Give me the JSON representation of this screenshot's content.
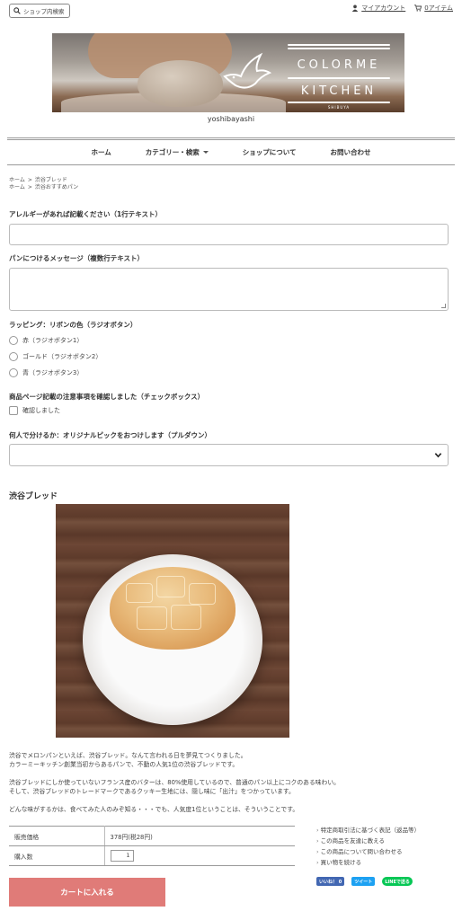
{
  "header": {
    "search_label": "ショップ内検索",
    "account_label": "マイアカウント",
    "cart_label": "0アイテム"
  },
  "banner": {
    "title_line1": "COLORME",
    "title_line2": "KITCHEN",
    "subtitle": "SHIBUYA"
  },
  "shop_name": "yoshibayashi",
  "nav": {
    "items": [
      "ホーム",
      "カテゴリー・検索",
      "ショップについて",
      "お問い合わせ"
    ]
  },
  "breadcrumb": {
    "row1": [
      "ホーム",
      "渋谷ブレッド"
    ],
    "row2": [
      "ホーム",
      "渋谷おすすめパン"
    ]
  },
  "form": {
    "allergy_label": "アレルギーがあれば記載ください（1行テキスト）",
    "message_label": "パンにつけるメッセージ（複数行テキスト）",
    "wrapping_label": "ラッピング：リボンの色（ラジオボタン）",
    "radio_options": [
      "赤（ラジオボタン1）",
      "ゴールド（ラジオボタン2）",
      "青（ラジオボタン3）"
    ],
    "notice_label": "商品ページ記載の注意事項を確認しました（チェックボックス）",
    "notice_checkbox": "確認しました",
    "share_label": "何人で分けるか：オリジナルピックをおつけします（プルダウン）"
  },
  "product": {
    "title": "渋谷ブレッド",
    "desc": [
      "渋谷でメロンパンといえば、渋谷ブレッド。なんて言われる日を夢見てつくりました。",
      "カラーミーキッチン創業当初からあるパンで、不動の人気1位の渋谷ブレッドです。",
      "",
      "渋谷ブレッドにしか使っていないフランス産のバターは、80%使用しているので、普通のパン以上にコクのある味わい。",
      "そして、渋谷ブレッドのトレードマークであるクッキー生地には、隠し味に「出汁」をつかっています。",
      "",
      "どんな味がするかは、食べてみた人のみぞ知る・・・でも、人気度1位ということは、そういうことです。"
    ],
    "price_label": "販売価格",
    "price_value": "378円(税28円)",
    "qty_label": "購入数",
    "qty_value": "1",
    "cart_button": "カートに入れる"
  },
  "side_links": [
    "特定商取引法に基づく表記（返品等）",
    "この商品を友達に教える",
    "この商品について問い合わせる",
    "買い物を続ける"
  ],
  "social": {
    "fb_label": "いいね！ 0",
    "tw_label": "ツイート",
    "line_label": "LINEで送る"
  }
}
